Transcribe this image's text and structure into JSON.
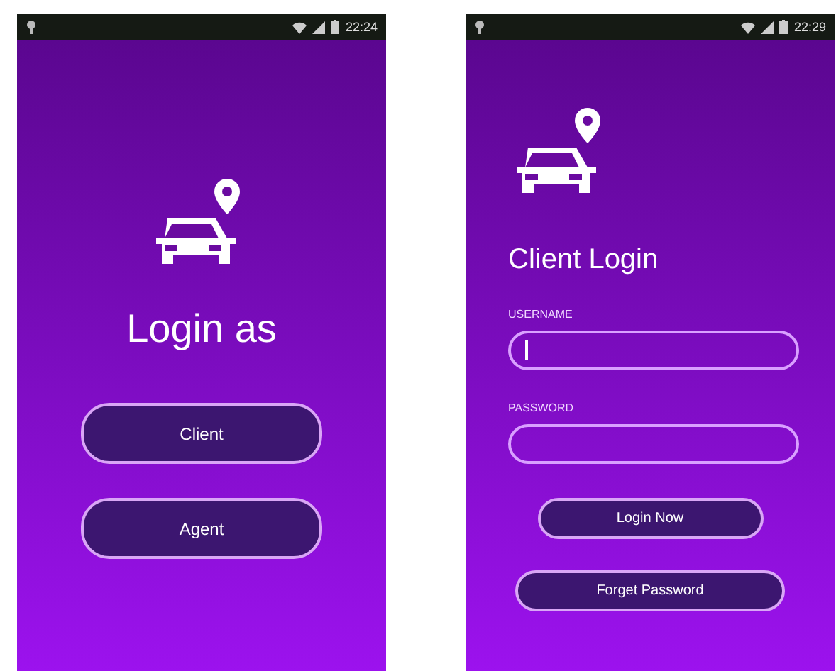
{
  "screens": [
    {
      "kind": "login-choice",
      "status_time": "22:24",
      "title": "Login as",
      "buttons": [
        "Client",
        "Agent"
      ]
    },
    {
      "kind": "client-login",
      "status_time": "22:29",
      "title": "Client Login",
      "fields": [
        {
          "label": "USERNAME",
          "focused": true
        },
        {
          "label": "PASSWORD",
          "focused": false
        }
      ],
      "buttons": [
        "Login Now",
        "Forget Password"
      ]
    }
  ]
}
